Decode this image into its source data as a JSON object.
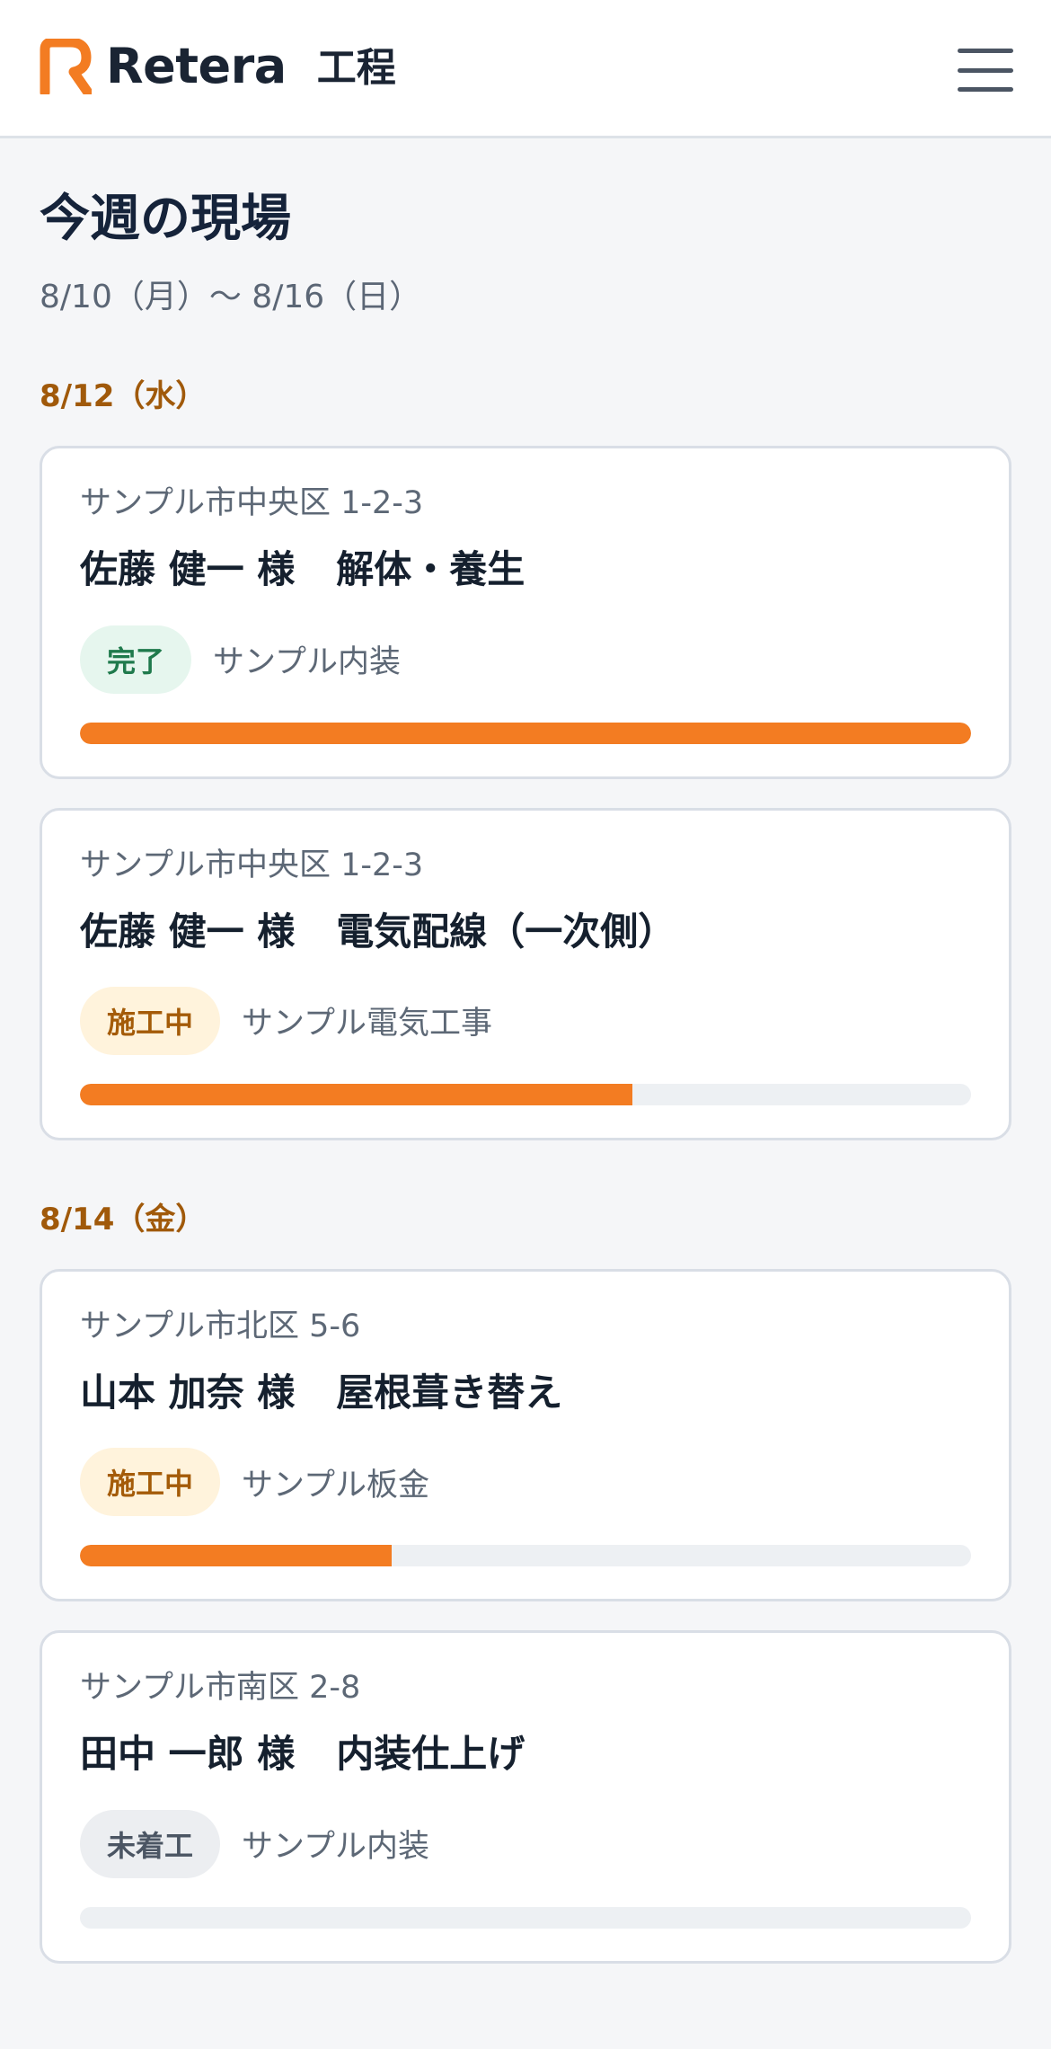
{
  "header": {
    "brand": "Retera",
    "section": "工程",
    "accent_color": "#f37c22"
  },
  "page": {
    "title": "今週の現場",
    "week_range": "8/10（月）〜 8/16（日）"
  },
  "days": [
    {
      "label": "8/12（水）",
      "jobs": [
        {
          "address": "サンプル市中央区 1-2-3",
          "client": "佐藤 健一 様",
          "task": "解体・養生",
          "status": "完了",
          "status_type": "done",
          "company": "サンプル内装",
          "progress": 1.0
        },
        {
          "address": "サンプル市中央区 1-2-3",
          "client": "佐藤 健一 様",
          "task": "電気配線（一次側）",
          "status": "施工中",
          "status_type": "wip",
          "company": "サンプル電気工事",
          "progress": 0.62
        }
      ]
    },
    {
      "label": "8/14（金）",
      "jobs": [
        {
          "address": "サンプル市北区 5-6",
          "client": "山本 加奈 様",
          "task": "屋根葺き替え",
          "status": "施工中",
          "status_type": "wip",
          "company": "サンプル板金",
          "progress": 0.35
        },
        {
          "address": "サンプル市南区 2-8",
          "client": "田中 一郎 様",
          "task": "内装仕上げ",
          "status": "未着工",
          "status_type": "todo",
          "company": "サンプル内装",
          "progress": 0.0
        }
      ]
    }
  ]
}
